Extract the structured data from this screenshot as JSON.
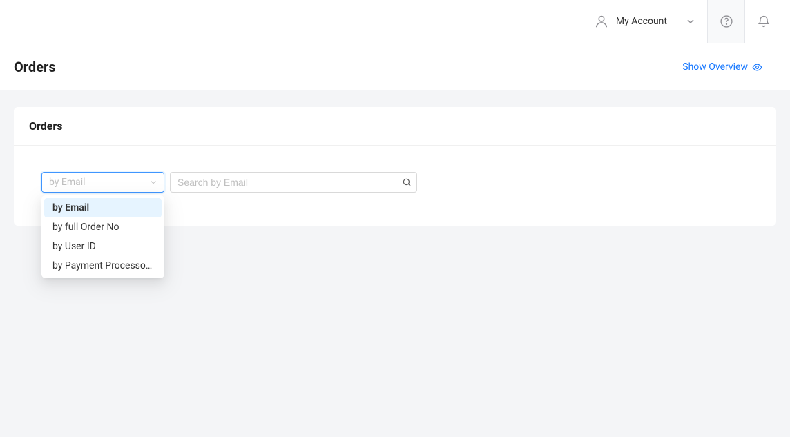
{
  "header": {
    "account_label": "My Account"
  },
  "titlebar": {
    "title": "Orders",
    "overview_link": "Show Overview"
  },
  "card": {
    "title": "Orders"
  },
  "filter": {
    "selected": "by Email",
    "options": [
      "by Email",
      "by full Order No",
      "by User ID",
      "by Payment Processor Transaction ID"
    ]
  },
  "search": {
    "placeholder": "Search by Email"
  }
}
